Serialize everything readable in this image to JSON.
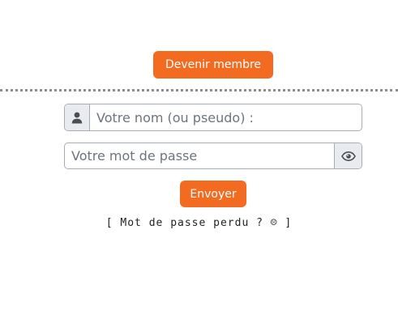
{
  "header": {
    "register_button": "Devenir membre"
  },
  "login_form": {
    "username": {
      "icon": "user-icon",
      "placeholder": "Votre nom (ou pseudo) :",
      "value": ""
    },
    "password": {
      "icon": "eye-icon",
      "placeholder": "Votre mot de passe",
      "value": ""
    },
    "submit_button": "Envoyer",
    "lost_password": {
      "open_bracket": "[ ",
      "link_text": "Mot de passe perdu ? ☹",
      "close_bracket": " ]"
    }
  },
  "colors": {
    "accent": "#f26b21",
    "addon_background": "#e9ecef",
    "input_border": "#a8adb3",
    "divider": "#8c8c8c"
  }
}
